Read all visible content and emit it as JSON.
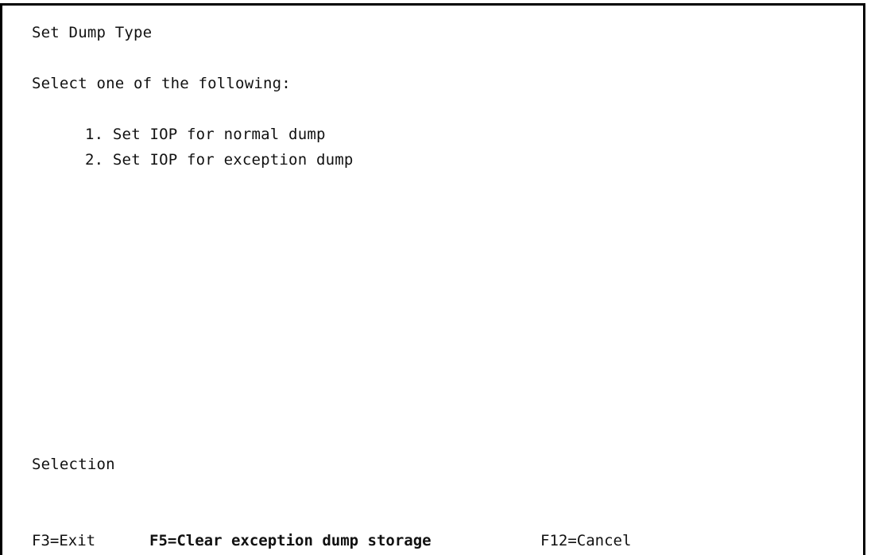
{
  "screen": {
    "title": "Set Dump Type",
    "instruction": "Select one of the following:",
    "options": [
      {
        "label": "1. Set IOP for normal dump"
      },
      {
        "label": "2. Set IOP for exception dump"
      }
    ],
    "selection_label": "Selection",
    "selection_value": ""
  },
  "function_keys": {
    "f3": "F3=Exit",
    "f5": "F5=Clear exception dump storage",
    "f12": "F12=Cancel"
  }
}
